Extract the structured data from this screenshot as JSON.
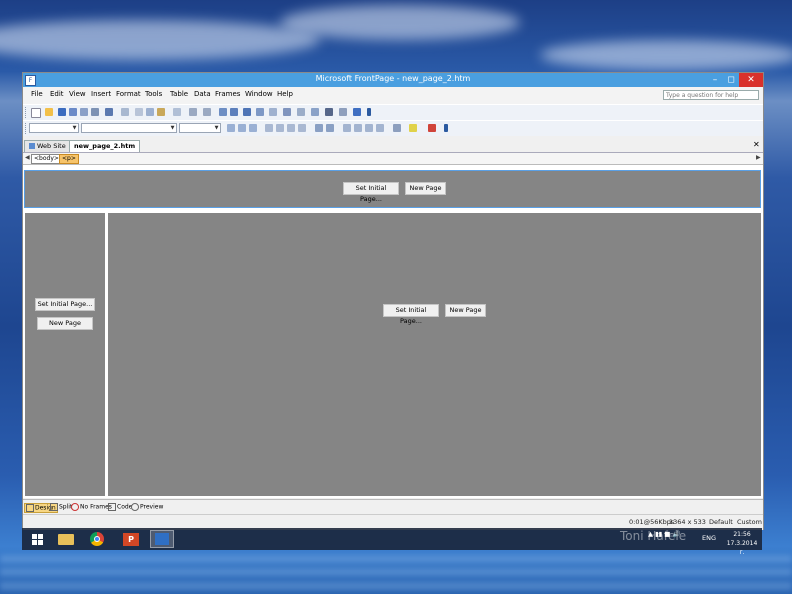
{
  "window": {
    "title": "Microsoft FrontPage - new_page_2.htm"
  },
  "menu": [
    "File",
    "Edit",
    "View",
    "Insert",
    "Format",
    "Tools",
    "Table",
    "Data",
    "Frames",
    "Window",
    "Help"
  ],
  "ask_placeholder": "Type a question for help",
  "tabs": {
    "website": "Web Site",
    "document": "new_page_2.htm"
  },
  "quicktag": {
    "body": "<body>",
    "p": "<p>"
  },
  "frames": {
    "top": {
      "set_initial": "Set Initial Page...",
      "new_page": "New Page"
    },
    "left": {
      "set_initial": "Set Initial Page...",
      "new_page": "New Page"
    },
    "main": {
      "set_initial": "Set Initial Page...",
      "new_page": "New Page"
    }
  },
  "views": {
    "design": "Design",
    "split": "Split",
    "no_frames": "No Frames",
    "code": "Code",
    "preview": "Preview"
  },
  "status": {
    "speed": "0:01@56Kbps",
    "size": "1364 x 533",
    "default": "Default",
    "custom": "Custom"
  },
  "taskbar": {
    "lang": "ENG",
    "time": "21:56",
    "date": "17.3.2014 г."
  },
  "watermark": "Toni Hafele",
  "colors": {
    "titlebar": "#4a9fe0",
    "frame_bg": "#858585",
    "close": "#d9312b"
  }
}
